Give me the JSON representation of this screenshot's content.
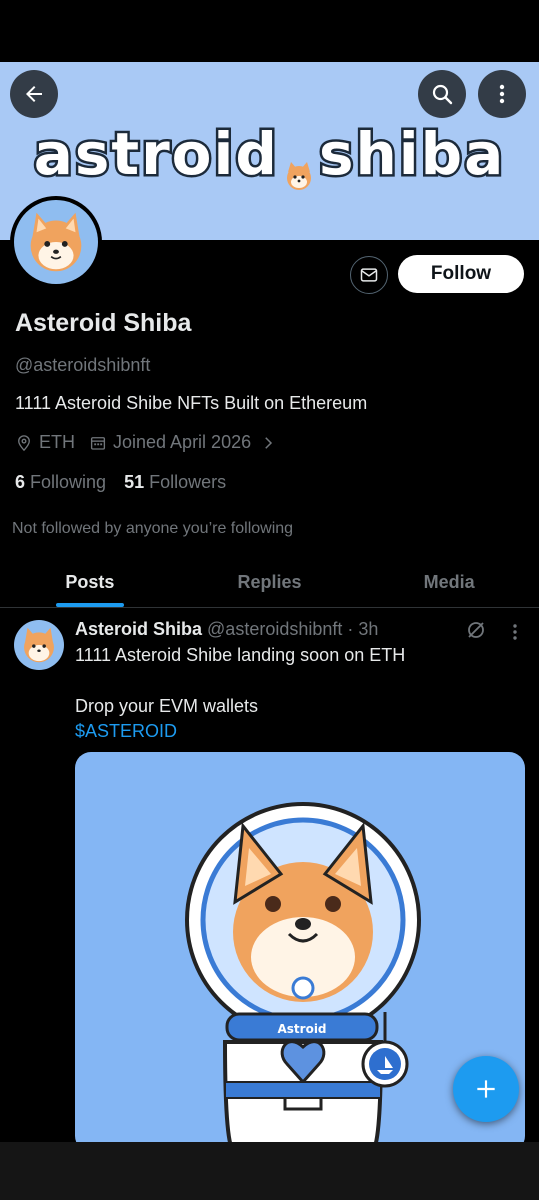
{
  "banner": {
    "title_left": "astroid",
    "title_right": "shiba"
  },
  "header": {
    "back_icon": "arrow-left-icon",
    "search_icon": "search-icon",
    "more_icon": "more-vertical-icon"
  },
  "profile": {
    "name": "Asteroid Shiba",
    "handle": "@asteroidshibnft",
    "bio": "1111 Asteroid Shibe NFTs  Built on Ethereum",
    "location": "ETH",
    "joined": "Joined April 2026",
    "following_count": "6",
    "following_label": "Following",
    "followers_count": "51",
    "followers_label": "Followers",
    "not_followed_text": "Not followed by anyone you’re following",
    "follow_label": "Follow"
  },
  "tabs": [
    {
      "label": "Posts",
      "active": true
    },
    {
      "label": "Replies",
      "active": false
    },
    {
      "label": "Media",
      "active": false
    }
  ],
  "post": {
    "name": "Asteroid Shiba",
    "handle_time": "@asteroidshibnft · 3h",
    "line1": "1111 Asteroid Shibe landing soon on ETH",
    "line2": "Drop your EVM wallets",
    "cashtag": "$ASTEROID",
    "media_badge": "Astroid"
  },
  "colors": {
    "accent": "#1d9bf0",
    "banner": "#a9c9f5",
    "media_bg": "#84b6f4"
  }
}
